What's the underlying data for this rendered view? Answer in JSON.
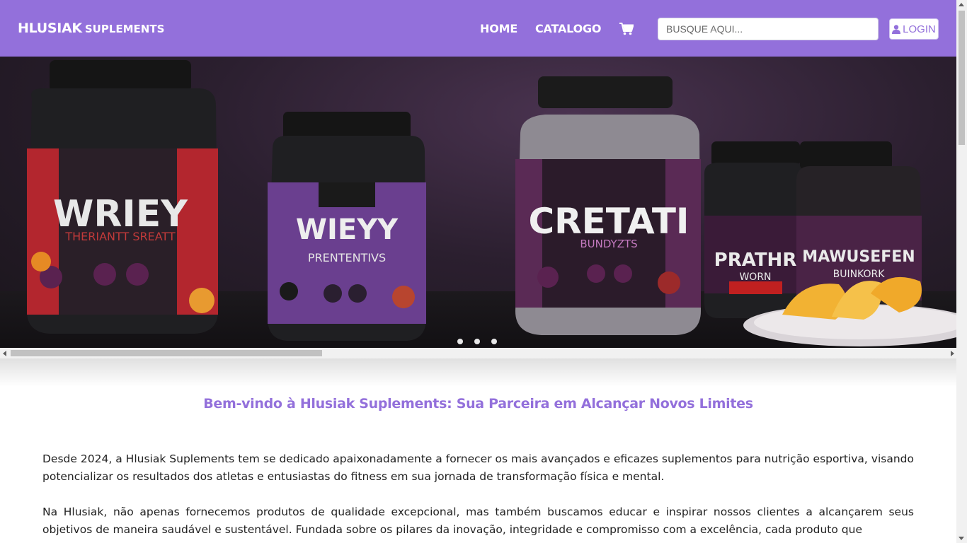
{
  "navbar": {
    "brand_main": "HLUSIAK",
    "brand_sub": "SUPLEMENTS",
    "links": {
      "home": "HOME",
      "catalog": "CATALOGO"
    },
    "search_placeholder": "BUSQUE AQUI...",
    "login_label": "LOGIN",
    "background_color": "#9370db"
  },
  "hero": {
    "products": [
      {
        "name": "WRIEY",
        "subtitle": "THERIANTT SREATT",
        "label_color": "#b3262e"
      },
      {
        "name": "WIEYY",
        "subtitle": "PRENTENTIVS",
        "label_color": "#6a3f8f"
      },
      {
        "name": "CRETATI",
        "subtitle": "BUNDYZTS",
        "label_color": "#5a2a55"
      },
      {
        "name": "PRATHR",
        "subtitle": "WORN",
        "label_color": "#3a1b38"
      },
      {
        "name": "MAWUSEFEN",
        "subtitle": "BUINKORK",
        "label_color": "#4a2346"
      }
    ],
    "carousel_slides": 3
  },
  "content": {
    "welcome_title": "Bem-vindo à Hlusiak Suplements: Sua Parceira em Alcançar Novos Limites",
    "paragraph_1": "Desde 2024, a Hlusiak Suplements tem se dedicado apaixonadamente a fornecer os mais avançados e eficazes suplementos para nutrição esportiva, visando potencializar os resultados dos atletas e entusiastas do fitness em sua jornada de transformação física e mental.",
    "paragraph_2": "Na Hlusiak, não apenas fornecemos produtos de qualidade excepcional, mas também buscamos educar e inspirar nossos clientes a alcançarem seus objetivos de maneira saudável e sustentável. Fundada sobre os pilares da inovação, integridade e compromisso com a excelência, cada produto que",
    "accent_color": "#9370db"
  }
}
